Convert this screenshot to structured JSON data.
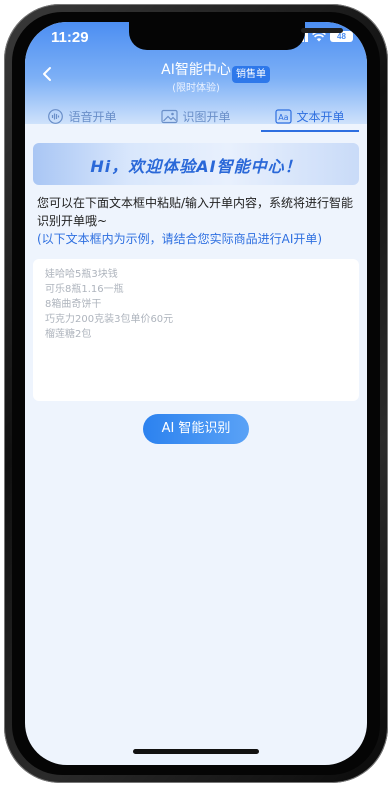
{
  "status_bar": {
    "time": "11:29",
    "battery": "48"
  },
  "header": {
    "title": "AI智能中心",
    "subtitle": "(限时体验)",
    "badge": "销售单"
  },
  "tabs": [
    {
      "label": "语音开单",
      "icon": "voice-wave-icon",
      "active": false
    },
    {
      "label": "识图开单",
      "icon": "image-icon",
      "active": false
    },
    {
      "label": "文本开单",
      "icon": "text-aa-icon",
      "active": true
    }
  ],
  "banner": {
    "text": "Hi，欢迎体验AI智能中心！"
  },
  "description": "您可以在下面文本框中粘贴/输入开单内容，系统将进行智能识别开单哦~",
  "note": "(以下文本框内为示例，请结合您实际商品进行AI开单)",
  "textbox": {
    "lines": [
      "娃哈哈5瓶3块钱",
      "可乐8瓶1.16一瓶",
      "8箱曲奇饼干",
      "巧克力200克装3包单价60元",
      "榴莲糖2包"
    ]
  },
  "ai_button": {
    "label": "AI 智能识别"
  },
  "colors": {
    "accent": "#2e6fe0",
    "header_top": "#4c8ef2",
    "background": "#eef4fd"
  }
}
